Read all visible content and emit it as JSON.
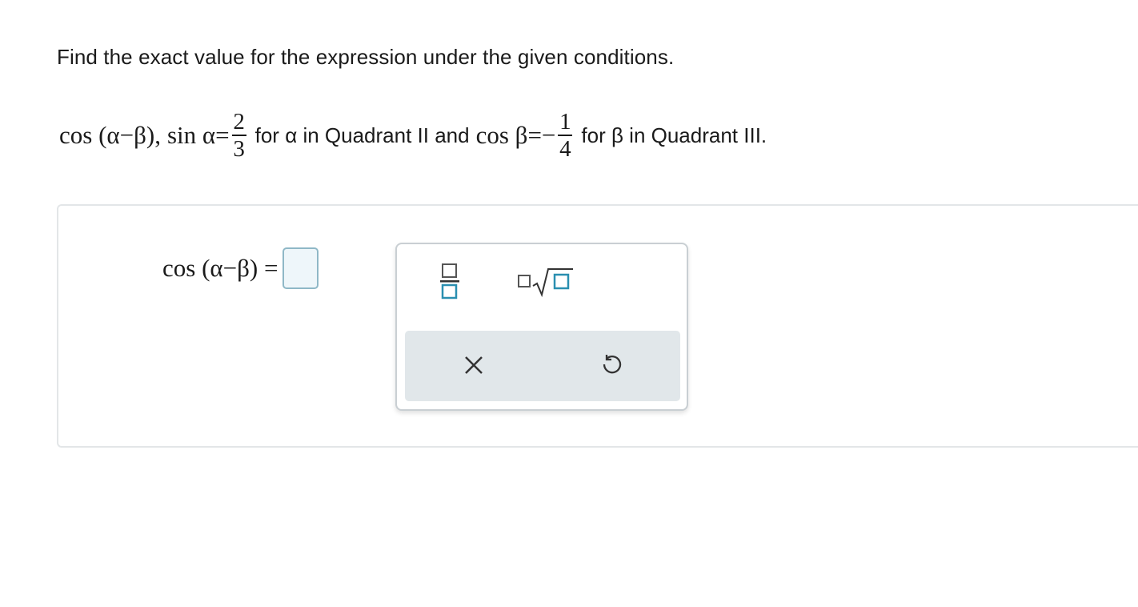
{
  "question": {
    "instruction": "Find the exact value for the expression under the given conditions.",
    "expression": "cos (α−β),",
    "sin_label": "sin α",
    "equals": "=",
    "sin_numerator": "2",
    "sin_denominator": "3",
    "alpha_condition": "for α in Quadrant II and",
    "cos_label": "cos β",
    "equals_neg": "=−",
    "cos_numerator": "1",
    "cos_denominator": "4",
    "beta_condition": "for β in Quadrant III."
  },
  "answer": {
    "lhs": "cos (α−β) =",
    "value": ""
  },
  "palette": {
    "tools": [
      "fraction-icon",
      "nth-root-icon"
    ],
    "actions": [
      "clear-icon",
      "undo-icon"
    ],
    "accent": "#2a8fb0"
  }
}
